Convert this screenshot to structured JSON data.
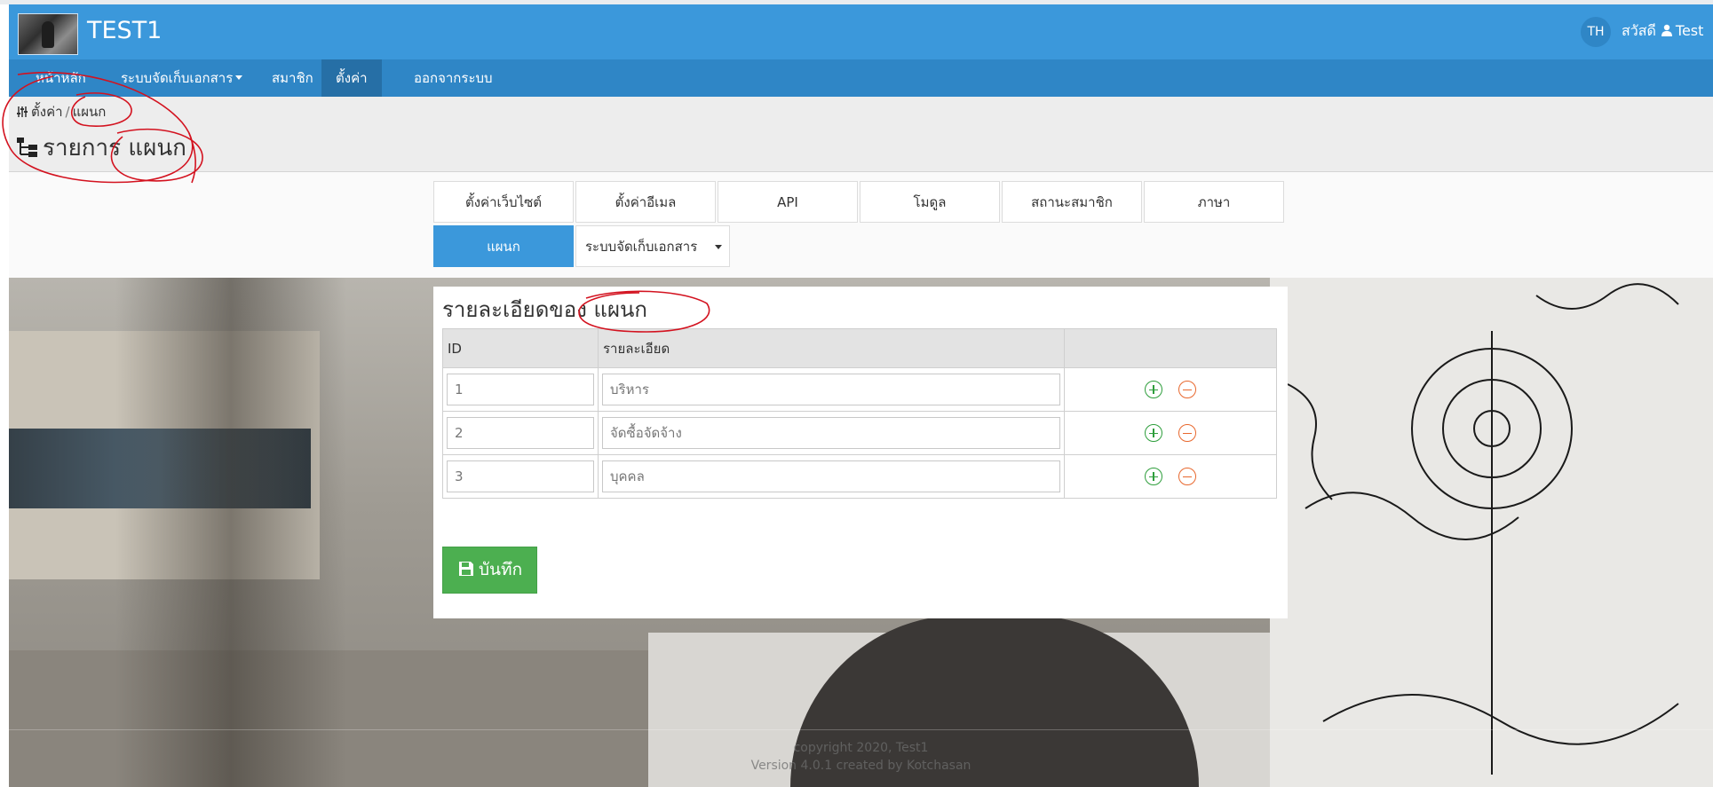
{
  "header": {
    "site_title": "TEST1",
    "language": "TH",
    "greeting": "สวัสดี",
    "user_name": "Test"
  },
  "nav": {
    "items": [
      {
        "label": "หน้าหลัก"
      },
      {
        "label": "ระบบจัดเก็บเอกสาร"
      },
      {
        "label": "สมาชิก"
      },
      {
        "label": "ตั้งค่า"
      },
      {
        "label": "ออกจากระบบ"
      }
    ],
    "active": "ตั้งค่า"
  },
  "breadcrumb": {
    "parent": "ตั้งค่า",
    "separator": "/",
    "current": "แผนก"
  },
  "page_title": {
    "prefix": "รายการ",
    "subject": "แผนก"
  },
  "tabs": {
    "row1": [
      "ตั้งค่าเว็บไซต์",
      "ตั้งค่าอีเมล",
      "API",
      "โมดูล",
      "สถานะสมาชิก",
      "ภาษา"
    ],
    "row2": [
      "แผนก",
      "ระบบจัดเก็บเอกสาร"
    ],
    "active": "แผนก"
  },
  "panel": {
    "title_prefix": "รายละเอียดของ",
    "title_subject": "แผนก",
    "columns": [
      "ID",
      "รายละเอียด",
      ""
    ],
    "rows": [
      {
        "id": "1",
        "detail": "บริหาร"
      },
      {
        "id": "2",
        "detail": "จัดซื้อจัดจ้าง"
      },
      {
        "id": "3",
        "detail": "บุคคล"
      }
    ],
    "save_label": "บันทึก"
  },
  "footer": {
    "copyright": "copyright 2020, Test1",
    "version": "Version 4.0.1 created by Kotchasan"
  },
  "colors": {
    "header": "#3b98db",
    "navbar": "#2f86c6",
    "add_icon": "#2e9e3c",
    "remove_icon": "#e8682e",
    "save_button": "#4caf50",
    "annotation": "#d3121f"
  }
}
